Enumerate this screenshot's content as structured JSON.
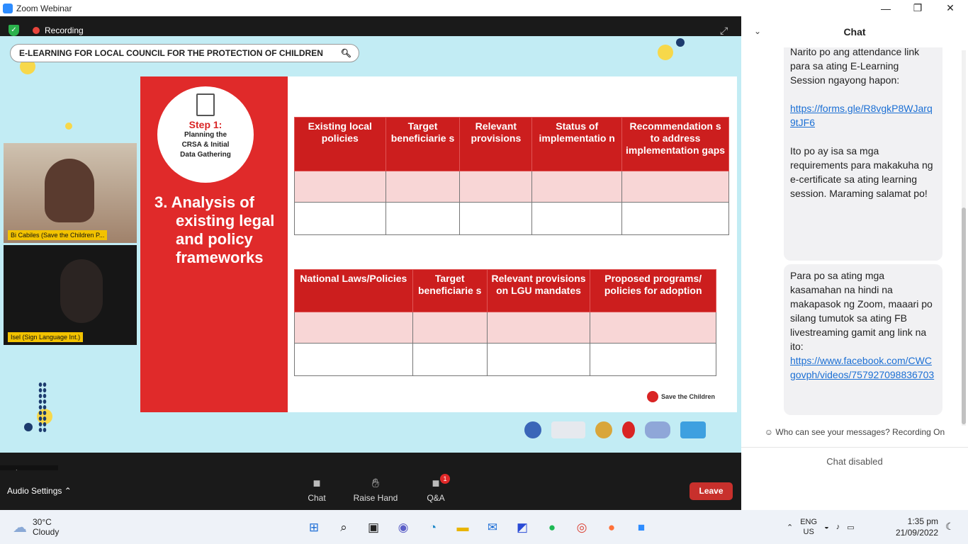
{
  "window": {
    "title": "Zoom Webinar"
  },
  "recording": {
    "label": "Recording"
  },
  "slide": {
    "search_text": "E-LEARNING FOR LOCAL COUNCIL FOR THE PROTECTION OF CHILDREN",
    "step_title": "Step 1:",
    "step_lines": [
      "Planning the",
      "CRSA & Initial",
      "Data Gathering"
    ],
    "analysis_lines": [
      "3. Analysis of",
      "existing legal",
      "and policy",
      "frameworks"
    ],
    "table1_headers": [
      "Existing local policies",
      "Target beneficiarie s",
      "Relevant provisions",
      "Status of implementatio n",
      "Recommendation s to address implementation gaps"
    ],
    "table2_headers": [
      "National Laws/Policies",
      "Target beneficiarie s",
      "Relevant provisions on LGU mandates",
      "Proposed programs/ policies for adoption"
    ],
    "footer_brand": "Save the Children"
  },
  "participants": [
    {
      "name": "Bi Cabiles (Save the Children P..."
    },
    {
      "name": "Isel (Sign Language Int.)"
    }
  ],
  "main_stream": "Main Stream",
  "toolbar": {
    "audio_settings": "Audio Settings",
    "chat": "Chat",
    "raise_hand": "Raise Hand",
    "qa": "Q&A",
    "qa_badge": "1",
    "leave": "Leave"
  },
  "chat": {
    "title": "Chat",
    "message1": {
      "text_a": "Narito po ang attendance link para sa ating E-Learning Session ngayong hapon:",
      "link": "https://forms.gle/R8vgkP8WJarq9tJF6",
      "text_b": "Ito po ay isa sa mga requirements para makakuha ng e-certificate sa ating learning session. Maraming salamat po!"
    },
    "message2": {
      "text": "Para po sa ating mga kasamahan na hindi na makapasok ng Zoom, maaari po silang tumutok sa ating FB livestreaming gamit ang link na ito:",
      "link": "https://www.facebook.com/CWCgovph/videos/757927098836703"
    },
    "who_can_see": "Who can see your messages? Recording On",
    "disabled": "Chat disabled"
  },
  "taskbar": {
    "weather_temp": "30°C",
    "weather_desc": "Cloudy",
    "lang_top": "ENG",
    "lang_bottom": "US",
    "time": "1:35 pm",
    "date": "21/09/2022"
  },
  "colors": {
    "accent_red": "#e02a2a",
    "slide_bg": "#c2ecf4",
    "link": "#1b6fd4"
  }
}
